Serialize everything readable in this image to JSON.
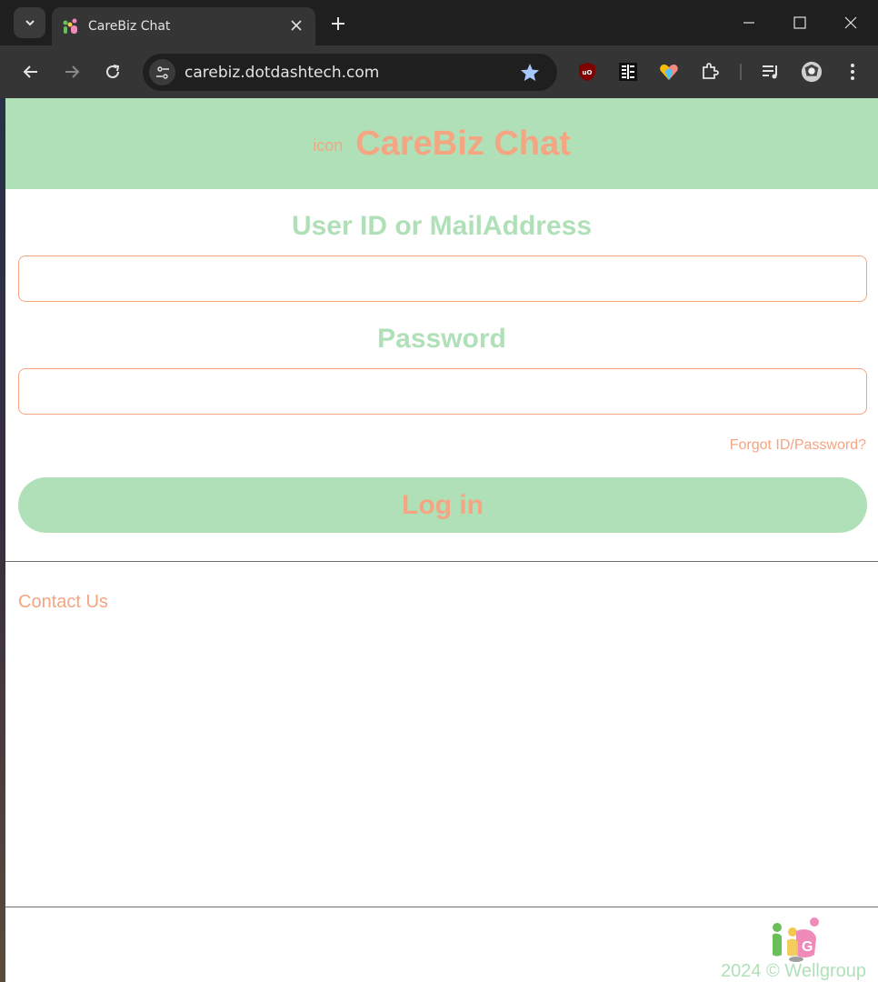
{
  "browser": {
    "tab_title": "CareBiz Chat",
    "url": "carebiz.dotdashtech.com"
  },
  "header": {
    "icon_alt": "icon",
    "title": "CareBiz Chat"
  },
  "form": {
    "user_label": "User ID or MailAddress",
    "user_value": "",
    "password_label": "Password",
    "password_value": "",
    "forgot_link": "Forgot ID/Password?",
    "login_button": "Log in"
  },
  "links": {
    "contact": "Contact Us"
  },
  "footer": {
    "copyright": "2024 © Wellgroup"
  },
  "colors": {
    "header_green": "#b0e0b8",
    "accent_orange": "#f4a582"
  }
}
